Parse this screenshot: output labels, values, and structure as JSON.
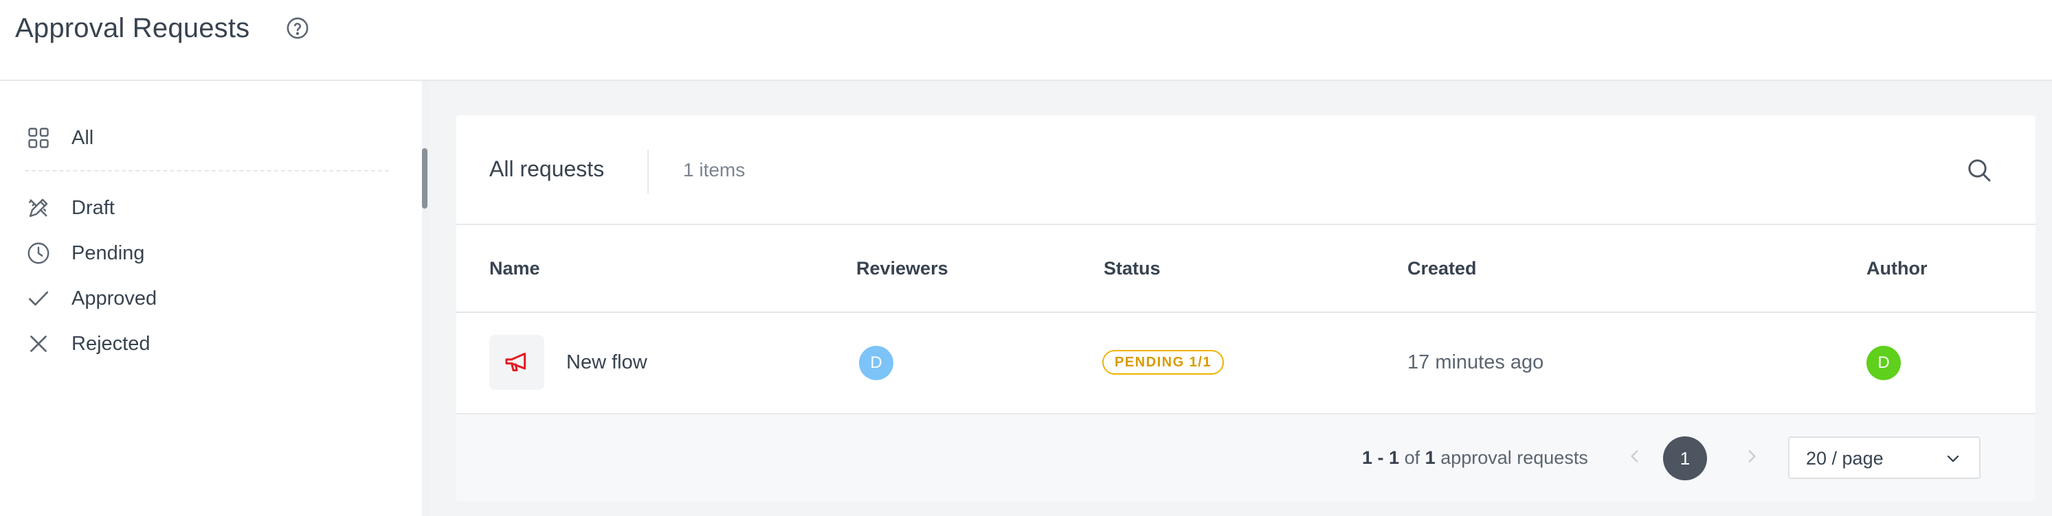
{
  "header": {
    "title": "Approval Requests"
  },
  "sidebar": {
    "items": [
      {
        "label": "All",
        "icon": "grid-icon"
      },
      {
        "label": "Draft",
        "icon": "pencil-ruler-icon"
      },
      {
        "label": "Pending",
        "icon": "clock-icon"
      },
      {
        "label": "Approved",
        "icon": "check-icon"
      },
      {
        "label": "Rejected",
        "icon": "x-icon"
      }
    ]
  },
  "main": {
    "title": "All requests",
    "item_count": "1 items",
    "columns": [
      "Name",
      "Reviewers",
      "Status",
      "Created",
      "Author"
    ],
    "rows": [
      {
        "name": "New flow",
        "icon": "megaphone-icon",
        "reviewer_initial": "D",
        "status": "PENDING 1/1",
        "created": "17 minutes ago",
        "author_initial": "D"
      }
    ],
    "pagination": {
      "range_start": "1",
      "range_end": "1",
      "of_label": "of",
      "total": "1",
      "suffix": "approval requests",
      "current_page": "1",
      "page_size": "20 / page"
    }
  },
  "colors": {
    "reviewer_avatar": "#7cc3f7",
    "author_avatar": "#5fd01c",
    "status_pending": "#f0b400",
    "megaphone": "#e31b23",
    "active_page": "#4c5560"
  }
}
